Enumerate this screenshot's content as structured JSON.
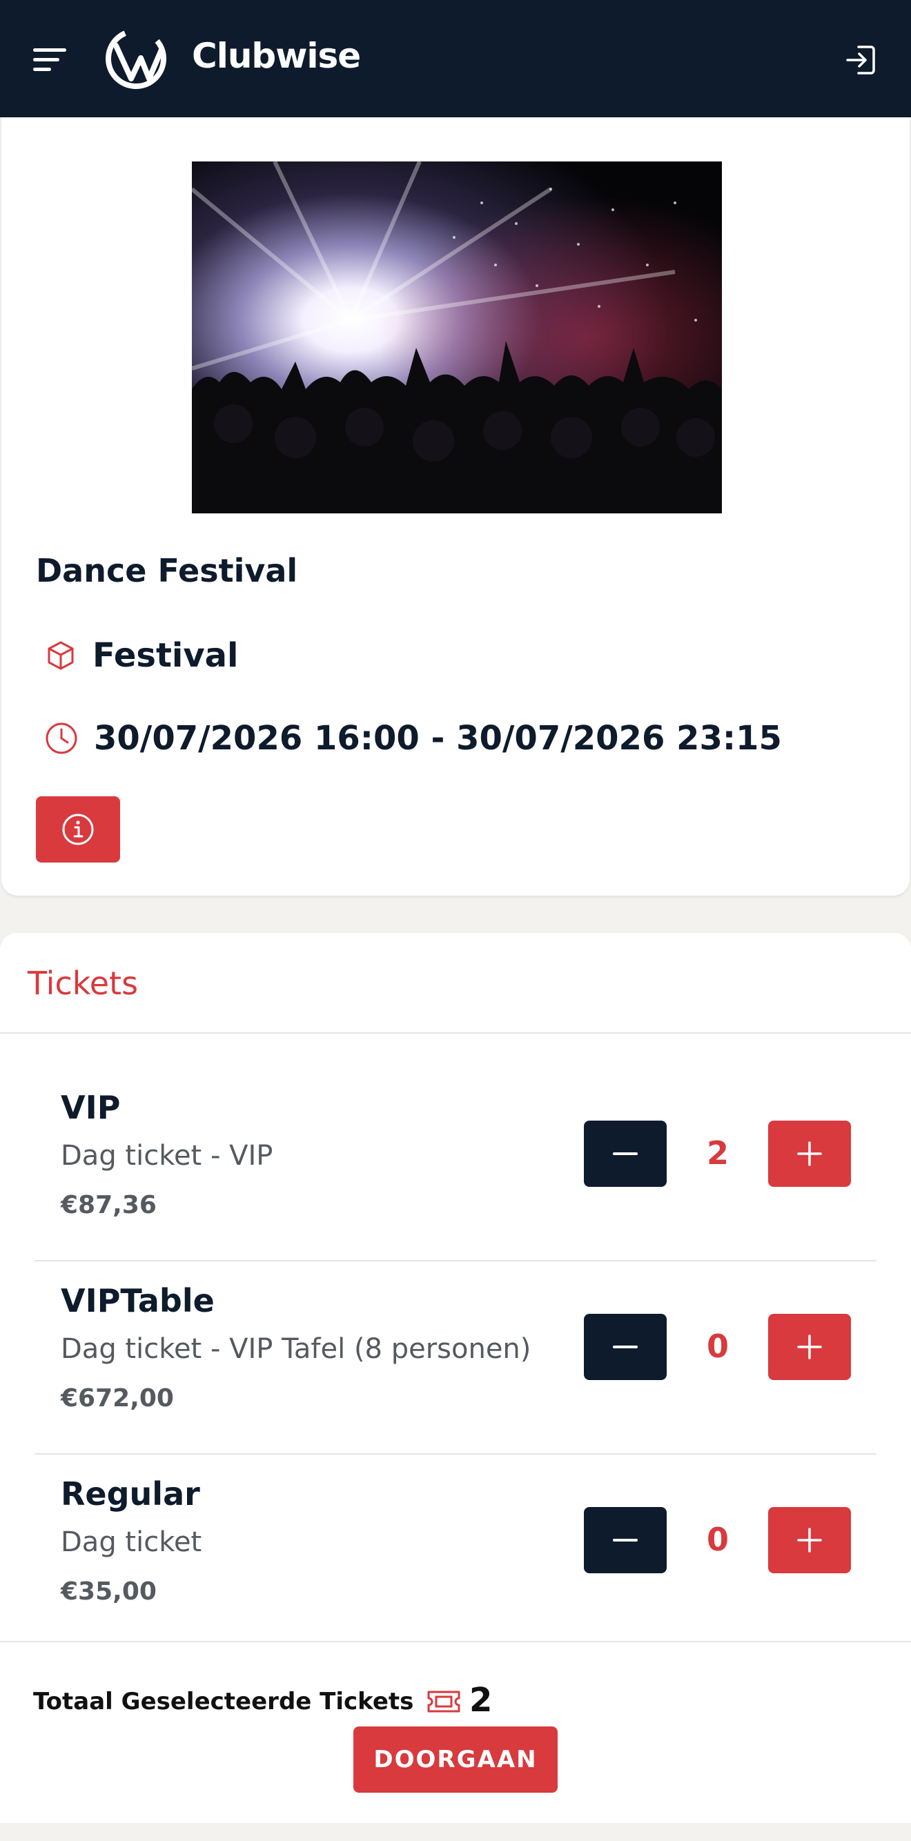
{
  "header": {
    "brand": "Clubwise",
    "menu_icon": "hamburger-menu-icon",
    "login_icon": "sign-in-icon"
  },
  "event": {
    "title": "Dance Festival",
    "category": "Festival",
    "datetime": "30/07/2026 16:00 - 30/07/2026 23:15",
    "category_icon": "cube-icon",
    "time_icon": "clock-icon",
    "info_icon": "info-icon"
  },
  "tickets": {
    "header": "Tickets",
    "items": [
      {
        "name": "VIP",
        "description": "Dag ticket - VIP",
        "price": "€87,36",
        "quantity": "2"
      },
      {
        "name": "VIPTable",
        "description": "Dag ticket - VIP Tafel (8 personen)",
        "price": "€672,00",
        "quantity": "0"
      },
      {
        "name": "Regular",
        "description": "Dag ticket",
        "price": "€35,00",
        "quantity": "0"
      }
    ]
  },
  "footer": {
    "total_label": "Totaal Geselecteerde Tickets",
    "total_count": "2",
    "continue_label": "DOORGAAN"
  },
  "colors": {
    "navy": "#0e1b2c",
    "accent_red": "#d83a3e"
  }
}
